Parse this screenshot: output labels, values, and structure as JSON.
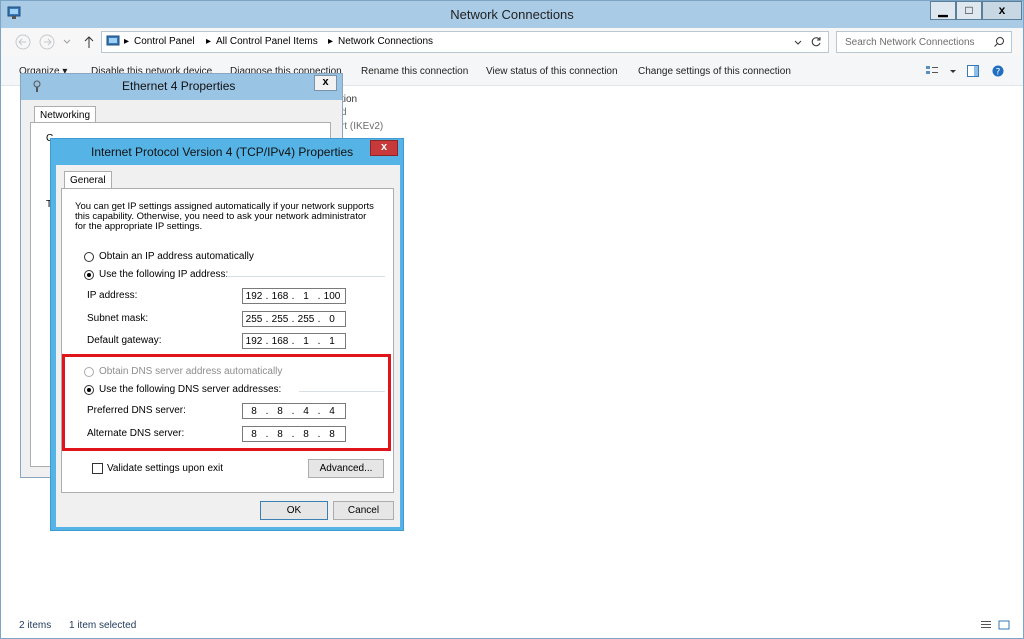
{
  "window": {
    "title": "Network Connections",
    "minimize": "▁",
    "maximize": "□",
    "close": "x"
  },
  "address": {
    "crumbs": [
      "Control Panel",
      "All Control Panel Items",
      "Network Connections"
    ],
    "separator": "▸",
    "search_placeholder": "Search Network Connections"
  },
  "toolbar": {
    "organize": "Organize ▾",
    "disable": "Disable this network device",
    "diagnose": "Diagnose this connection",
    "rename": "Rename this connection",
    "view_status": "View status of this connection",
    "change_settings": "Change settings of this connection"
  },
  "background_list": {
    "frag1": "tion",
    "frag2": "d",
    "frag3": "rt (IKEv2)"
  },
  "status": {
    "items": "2 items",
    "selected": "1 item selected"
  },
  "ethernet_dialog": {
    "title": "Ethernet 4 Properties",
    "close": "x",
    "tab": "Networking",
    "frag_c": "C",
    "frag_t": "T"
  },
  "ipv4_dialog": {
    "title": "Internet Protocol Version 4 (TCP/IPv4) Properties",
    "close": "x",
    "tab": "General",
    "description": [
      "You can get IP settings assigned automatically if your network supports",
      "this capability. Otherwise, you need to ask your network administrator",
      "for the appropriate IP settings."
    ],
    "obtain_ip_auto": "Obtain an IP address automatically",
    "use_following_ip": "Use the following IP address:",
    "ip_address_label": "IP address:",
    "ip_address": [
      "192",
      "168",
      "1",
      "100"
    ],
    "subnet_label": "Subnet mask:",
    "subnet": [
      "255",
      "255",
      "255",
      "0"
    ],
    "gateway_label": "Default gateway:",
    "gateway": [
      "192",
      "168",
      "1",
      "1"
    ],
    "obtain_dns_auto": "Obtain DNS server address automatically",
    "use_following_dns": "Use the following DNS server addresses:",
    "preferred_dns_label": "Preferred DNS server:",
    "preferred_dns": [
      "8",
      "8",
      "4",
      "4"
    ],
    "alternate_dns_label": "Alternate DNS server:",
    "alternate_dns": [
      "8",
      "8",
      "8",
      "8"
    ],
    "validate_label": "Validate settings upon exit",
    "advanced": "Advanced...",
    "ok": "OK",
    "cancel": "Cancel",
    "ip_dot": "."
  },
  "colors": {
    "highlight": "#e0151c",
    "title_active": "#56b3e6"
  }
}
